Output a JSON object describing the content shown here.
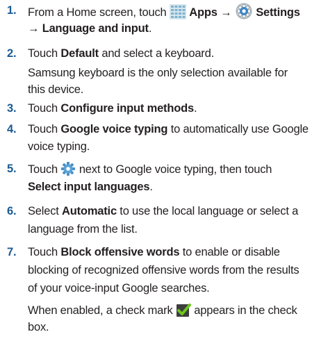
{
  "steps": [
    {
      "num": "1.",
      "l1_pre": "From a Home screen, touch ",
      "apps": "Apps",
      "arrow1": " → ",
      "settings": "Settings",
      "arrow2": "→ ",
      "lang": "Language and input",
      "end": "."
    },
    {
      "num": "2.",
      "pre": "Touch ",
      "default": "Default",
      "post": " and select a keyboard.",
      "note_l1": "Samsung keyboard is the only selection available for",
      "note_l2": "this device."
    },
    {
      "num": "3.",
      "pre": "Touch ",
      "bold": "Configure input methods",
      "end": "."
    },
    {
      "num": "4.",
      "pre": "Touch ",
      "bold": "Google voice typing",
      "post": " to automatically use Google",
      "l2": "voice typing."
    },
    {
      "num": "5.",
      "pre": "Touch ",
      "post": " next to Google voice typing, then touch",
      "bold": "Select input languages",
      "end": "."
    },
    {
      "num": "6.",
      "pre": "Select ",
      "bold": "Automatic",
      "post": " to use the local language or select a",
      "l2": "language from the list."
    },
    {
      "num": "7.",
      "pre": "Touch ",
      "bold": "Block offensive words",
      "post": " to enable or disable",
      "l2": "blocking of recognized offensive words from the results",
      "l3": "of your voice-input Google searches.",
      "note_pre": "When enabled, a check mark ",
      "note_post": " appears in the check",
      "note_l2": "box."
    }
  ],
  "icons": {
    "apps": "apps-grid-icon",
    "settings": "settings-gear-icon",
    "gear": "gear-icon",
    "checkbox": "checkbox-checked-icon"
  },
  "colors": {
    "step_number": "#1b5a93",
    "text": "#231f20",
    "check": "#4a9a1a"
  }
}
